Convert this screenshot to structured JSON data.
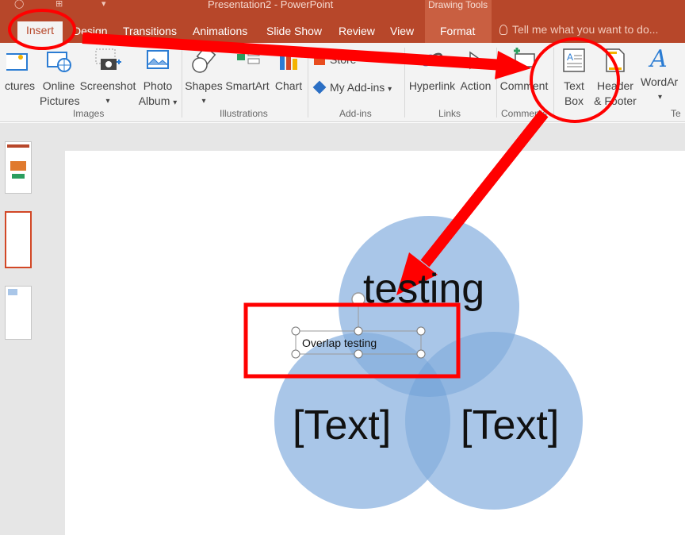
{
  "window": {
    "title": "Presentation2 - PowerPoint",
    "contextual_tab_group": "Drawing Tools"
  },
  "tabs": [
    {
      "label": "Insert"
    },
    {
      "label": "Design"
    },
    {
      "label": "Transitions"
    },
    {
      "label": "Animations"
    },
    {
      "label": "Slide Show"
    },
    {
      "label": "Review"
    },
    {
      "label": "View"
    },
    {
      "label": "Format"
    }
  ],
  "tell_me": {
    "placeholder": "Tell me what you want to do..."
  },
  "ribbon": {
    "images": {
      "pictures": "ctures",
      "online_pictures_1": "Online",
      "online_pictures_2": "Pictures",
      "screenshot": "Screenshot",
      "photo_album_1": "Photo",
      "photo_album_2": "Album",
      "label": "Images"
    },
    "illustrations": {
      "shapes": "Shapes",
      "smartart": "SmartArt",
      "chart": "Chart",
      "label": "Illustrations"
    },
    "addins": {
      "store": "Store",
      "my_addins": "My Add-ins",
      "label": "Add-ins"
    },
    "links": {
      "hyperlink": "Hyperlink",
      "action": "Action",
      "label": "Links"
    },
    "comments": {
      "comment": "Comment",
      "label": "Comments"
    },
    "text": {
      "text_box_1": "Text",
      "text_box_2": "Box",
      "header_footer_1": "Header",
      "header_footer_2": "& Footer",
      "wordart": "WordAr",
      "label": "Te"
    }
  },
  "slide": {
    "top_circle_text": "testing",
    "left_circle_text": "[Text]",
    "right_circle_text": "[Text]",
    "textbox_text": "Overlap testing"
  },
  "colors": {
    "accent": "#b7472a",
    "annotation_red": "#ff0000",
    "venn_fill": "#a9c6e8",
    "venn_overlap": "#7eaadb"
  }
}
